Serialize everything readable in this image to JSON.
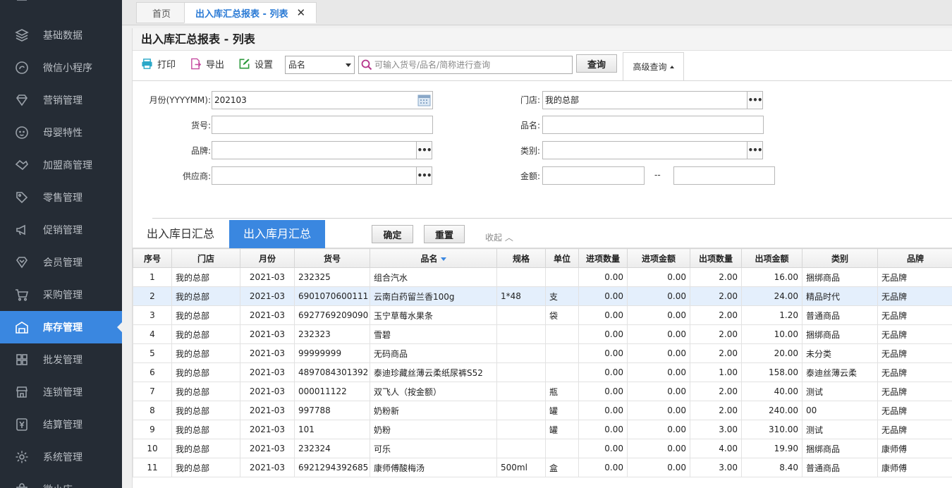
{
  "sidebar": {
    "items": [
      {
        "label": "",
        "icon": "menu-icon"
      },
      {
        "label": "基础数据",
        "icon": "layers-icon"
      },
      {
        "label": "微信小程序",
        "icon": "miniprogram-icon"
      },
      {
        "label": "营销管理",
        "icon": "diamond-icon"
      },
      {
        "label": "母婴特性",
        "icon": "baby-icon"
      },
      {
        "label": "加盟商管理",
        "icon": "handshake-icon"
      },
      {
        "label": "零售管理",
        "icon": "tag-icon"
      },
      {
        "label": "促销管理",
        "icon": "megaphone-icon"
      },
      {
        "label": "会员管理",
        "icon": "member-diamond-icon"
      },
      {
        "label": "采购管理",
        "icon": "cart-icon"
      },
      {
        "label": "库存管理",
        "icon": "warehouse-icon",
        "active": true
      },
      {
        "label": "批发管理",
        "icon": "boxes-icon"
      },
      {
        "label": "连锁管理",
        "icon": "store-icon"
      },
      {
        "label": "结算管理",
        "icon": "yen-icon"
      },
      {
        "label": "系统管理",
        "icon": "gear-icon"
      },
      {
        "label": "微小店",
        "icon": "shop-icon"
      }
    ]
  },
  "tabs": {
    "home": "首页",
    "active": "出入库汇总报表 - 列表",
    "close": "✕"
  },
  "page": {
    "title": "出入库汇总报表 - 列表"
  },
  "toolbar": {
    "print": "打印",
    "export": "导出",
    "settings": "设置",
    "select_value": "品名",
    "search_placeholder": "可输入货号/品名/简称进行查询",
    "query": "查询",
    "advanced": "高级查询"
  },
  "form": {
    "month_label": "月份(YYYYMM):",
    "month_value": "202103",
    "store_label": "门店:",
    "store_value": "我的总部",
    "code_label": "货号:",
    "code_value": "",
    "name_label": "品名:",
    "name_value": "",
    "brand_label": "品牌:",
    "brand_value": "",
    "category_label": "类别:",
    "category_value": "",
    "supplier_label": "供应商:",
    "supplier_value": "",
    "amount_label": "金额:",
    "amount_from": "",
    "amount_sep": "--",
    "amount_to": "",
    "ok": "确定",
    "reset": "重置",
    "collapse": "收起 ︿",
    "dots": "•••"
  },
  "subtabs": {
    "daily": "出入库日汇总",
    "monthly": "出入库月汇总"
  },
  "table": {
    "headers": [
      "序号",
      "门店",
      "月份",
      "货号",
      "品名",
      "规格",
      "单位",
      "进项数量",
      "进项金额",
      "出项数量",
      "出项金额",
      "类别",
      "品牌"
    ],
    "rows": [
      [
        "1",
        "我的总部",
        "2021-03",
        "232325",
        "组合汽水",
        "",
        "",
        "0.00",
        "0.00",
        "2.00",
        "16.00",
        "捆绑商品",
        "无品牌"
      ],
      [
        "2",
        "我的总部",
        "2021-03",
        "6901070600111",
        "云南白药留兰香100g",
        "1*48",
        "支",
        "0.00",
        "0.00",
        "2.00",
        "24.00",
        "精品时代",
        "无品牌"
      ],
      [
        "3",
        "我的总部",
        "2021-03",
        "6927769209090",
        "玉宁草莓水果条",
        "",
        "袋",
        "0.00",
        "0.00",
        "2.00",
        "1.20",
        "普通商品",
        "无品牌"
      ],
      [
        "4",
        "我的总部",
        "2021-03",
        "232323",
        "雪碧",
        "",
        "",
        "0.00",
        "0.00",
        "2.00",
        "10.00",
        "捆绑商品",
        "无品牌"
      ],
      [
        "5",
        "我的总部",
        "2021-03",
        "99999999",
        "无码商品",
        "",
        "",
        "0.00",
        "0.00",
        "2.00",
        "20.00",
        "未分类",
        "无品牌"
      ],
      [
        "6",
        "我的总部",
        "2021-03",
        "4897084301392",
        "泰迪珍藏丝薄云柔纸尿裤S52",
        "",
        "",
        "0.00",
        "0.00",
        "1.00",
        "158.00",
        "泰迪丝薄云柔",
        "无品牌"
      ],
      [
        "7",
        "我的总部",
        "2021-03",
        "000011122",
        "双飞人（按金额）",
        "",
        "瓶",
        "0.00",
        "0.00",
        "2.00",
        "40.00",
        "测试",
        "无品牌"
      ],
      [
        "8",
        "我的总部",
        "2021-03",
        "997788",
        "奶粉新",
        "",
        "罐",
        "0.00",
        "0.00",
        "2.00",
        "240.00",
        "00",
        "无品牌"
      ],
      [
        "9",
        "我的总部",
        "2021-03",
        "101",
        "奶粉",
        "",
        "罐",
        "0.00",
        "0.00",
        "3.00",
        "310.00",
        "测试",
        "无品牌"
      ],
      [
        "10",
        "我的总部",
        "2021-03",
        "232324",
        "可乐",
        "",
        "",
        "0.00",
        "0.00",
        "4.00",
        "19.90",
        "捆绑商品",
        "康师傅"
      ],
      [
        "11",
        "我的总部",
        "2021-03",
        "6921294392685",
        "康师傅酸梅汤",
        "500ml",
        "盒",
        "0.00",
        "0.00",
        "3.00",
        "8.40",
        "普通商品",
        "康师傅"
      ]
    ]
  }
}
